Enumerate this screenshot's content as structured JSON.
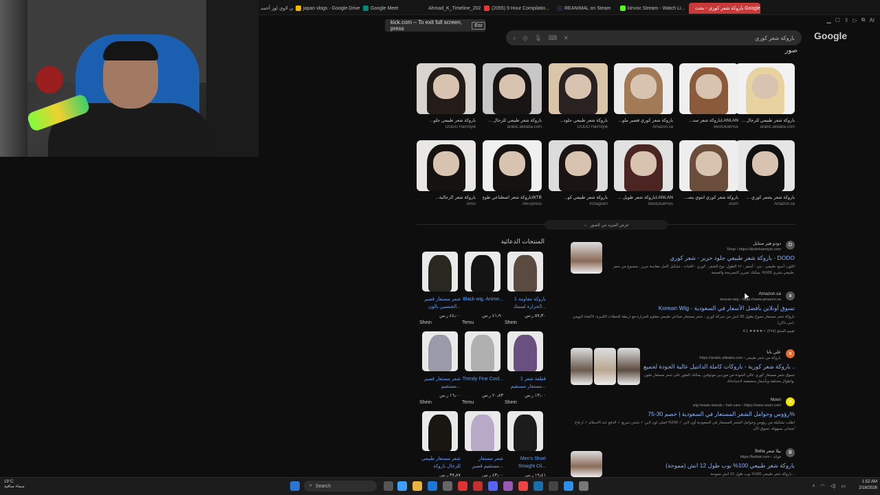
{
  "browser": {
    "tabs": [
      {
        "label": "كامي لاوي لوز أحمد",
        "color": "#8a8a8a"
      },
      {
        "label": "japan vlogs - Google Drive",
        "color": "#f4b400"
      },
      {
        "label": "Google Meet",
        "color": "#00897b"
      },
      {
        "label": "Ahmad_K_Timeline_2021...",
        "color": "#34a853"
      },
      {
        "label": "(2055) 9 Hour Compilatio...",
        "color": "#e53935"
      },
      {
        "label": "REANIMAL on Steam",
        "color": "#1b2838"
      },
      {
        "label": "kinvoc Stream - Watch Li...",
        "color": "#53fc18"
      },
      {
        "label": "باروكة شعر كوري - بحث Google",
        "color": "#ffffff"
      }
    ],
    "fullscreen_notice": "kick.com – To exit full screen, press",
    "fullscreen_key": "Esc",
    "toolbar_label": "AI"
  },
  "search": {
    "query": "باروكة شعر كوري",
    "logo": "Google",
    "section_title": "صور"
  },
  "images": [
    {
      "caption": "باروكة شعر طبيعي للرجال ...",
      "source": "arabic.alibaba.com",
      "hair": "#e8d2a0",
      "bg": "#f2f2f2"
    },
    {
      "caption": "LANLANباروكة شعر سد...",
      "source": "BestDealPlus",
      "hair": "#8a5a3a",
      "bg": "#efefef"
    },
    {
      "caption": "باروكة شعر كوري قصير ملو...",
      "source": "Amazon.sa",
      "hair": "#a27a55",
      "bg": "#ececec"
    },
    {
      "caption": "باروكة شعر طبيعي جلود...",
      "source": "DODO HairStyle",
      "hair": "#2a2220",
      "bg": "#d9c5a8"
    },
    {
      "caption": "باروكة شعر طبيعي للرجال ...",
      "source": "arabic.alibaba.com",
      "hair": "#1a1515",
      "bg": "#c7c7c7"
    },
    {
      "caption": "باروكة شعر طبيعي جلو...",
      "source": "DODO HairStyle",
      "hair": "#231c18",
      "bg": "#d8d3cf"
    },
    {
      "caption": "باروكة شعر بشعر كوري ...",
      "source": "Amazon.sa",
      "hair": "#111111",
      "bg": "#e5e5e5"
    },
    {
      "caption": "باروكة شعر كوري انثوي بشـ...",
      "source": "Joom",
      "hair": "#6b4d3c",
      "bg": "#eeeeee"
    },
    {
      "caption": "LANLANباروكة شعر طويل ...",
      "source": "BestDealPlus",
      "hair": "#4a2522",
      "bg": "#e1e1e1"
    },
    {
      "caption": "باروكة شعر طبيعي كو...",
      "source": "Instagram",
      "hair": "#1a1414",
      "bg": "#dcdcdc"
    },
    {
      "caption": "WTBباروكة شعر اصطناعي طوي...",
      "source": "AliExpress",
      "hair": "#161212",
      "bg": "#f0f0f0"
    },
    {
      "caption": "باروكة شعر الرجالية...",
      "source": "Temu",
      "hair": "#151210",
      "bg": "#e9e7e4"
    }
  ],
  "more_images_label": "عرض المزيد من الصور",
  "ads": {
    "title": "المنتجات الدعائية",
    "products": [
      {
        "name": "باروكة مقاومة 1 الحرارة لسمك...",
        "price": "٥٧٫٣٠ ر.س",
        "store": "Shein",
        "hair": "#5a4a40"
      },
      {
        "name": "Black wig, Anime...",
        "price": "٤١٫٩٠ ر.س",
        "store": "Temu",
        "hair": "#141414"
      },
      {
        "name": "شعر مستعار قصير الجنسين بالون...",
        "price": "٤٤٫٠٠ ر.س",
        "store": "Shein",
        "hair": "#2a2620"
      },
      {
        "name": "1 قطعة شعر مستعار مستقيم...",
        "price": "١٣٫٠٠ ر.س",
        "store": "Shein",
        "hair": "#6a5080"
      },
      {
        "name": "Trendy Fine Cool...",
        "price": "٢٠٫٨٣ ر.س",
        "store": "Temu",
        "hair": "#b0b0b0"
      },
      {
        "name": "شعر مستعار قصير مستقيم...",
        "price": "١٦٫٠٠ ر.س",
        "store": "Shein",
        "hair": "#9a9aa8"
      },
      {
        "name": "Men's Short Straight Cli...",
        "price": "١٩٫٤١ ر.س",
        "store": "",
        "hair": "#1c1c1c"
      },
      {
        "name": "شعر مستعار مستقيم قصير...",
        "price": "٤٣٫٠٠ ر.س",
        "store": "",
        "hair": "#b9a9c9"
      },
      {
        "name": "شعر مستعار طبيعي للرجال باروكة",
        "price": "٣٧٫٨٧ ر.س",
        "store": "",
        "hair": "#191612"
      }
    ]
  },
  "results": [
    {
      "site": "دودو هير ستايل",
      "url": "Shop › https://dodohairstyle.com",
      "title": "باروكة شعر طبيعي جلود حرير - شعر كوري - DODO",
      "snippet": "اللون: أسود طبيعي - بني - أشقر ، ١٢ الطول: نوع الشعر : كوري - لاقبات ، تشكيل كامل مقاسة حرير ، مصنوع من شعر طبيعي بشري 100%. يمكنك تغيرير التسريحة والصبغة.",
      "fav": "D",
      "fav_color": "#555"
    },
    {
      "site": "Amazon.sa",
      "url": "korean-wig › https://www.amazon.sa",
      "title": "Korean Wig - تسوق أونلاين بأفضل الأسعار في السعودية",
      "snippet": "باروكة شعر مستعار مموج بطول 28 انش من شركة كوري ، شعر مستعار صناعي طبيعي مقاوم للحرارة مع اربطة للحفلات الكبيرة، لاكتفاء اليومي (بني داكن).",
      "rating": "4.1 ★★★★☆ (٢٧٨) تقييم المنتج",
      "fav": "a",
      "fav_color": "#555"
    },
    {
      "site": "علي بابا",
      "url": "https://arabic.alibaba.com › باروكة من شعر طبيعي",
      "title": "باروكة شعر كورية - باروكات كاملة الدانتيل عالية الجودة لجميع ...",
      "snippet": "تسوق شعر مستعار كوري عالي الجودة من موردين موثوقين. يمكنك العثور على شعر مستعار ملون واطوال مختلفة وبأسعار منخفضة لاحتياجاتك.",
      "fav": "a",
      "fav_color": "#e56a2c"
    },
    {
      "site": "Noon",
      "url": "wig-heads-stands › hair-care › https://www.noon.com",
      "title": "رؤوس وحوامل الشعر المستعار في السعودية | خصم 30-75%",
      "snippet": "اطلب تشكيلة من رؤوس وحوامل الشعر المستعار في السعودية أون لاين ✓ 100% اصلي اون لاين ✓ شحن سريع ✓ الدفع عند الاستلام ✓ ارجاع مجاني بسهولة. تسوق الآن!",
      "fav": "n",
      "fav_color": "#f3e500"
    },
    {
      "site": "Bella بيلا شعر",
      "url": "https://bellatr.com › فوائد",
      "title": "باروكة شعر طبيعي 100% بوب طول 12 انش (مموجة)",
      "snippet": "باروكة شعر طبيعي 100% بوب طول 12 انش مموجة...",
      "fav": "B",
      "fav_color": "#555"
    }
  ],
  "taskbar": {
    "weather_temp": "19°C",
    "weather_desc": "سماء صافية",
    "search_label": "Search",
    "time": "1:52 AM",
    "date": "2/18/2026"
  }
}
